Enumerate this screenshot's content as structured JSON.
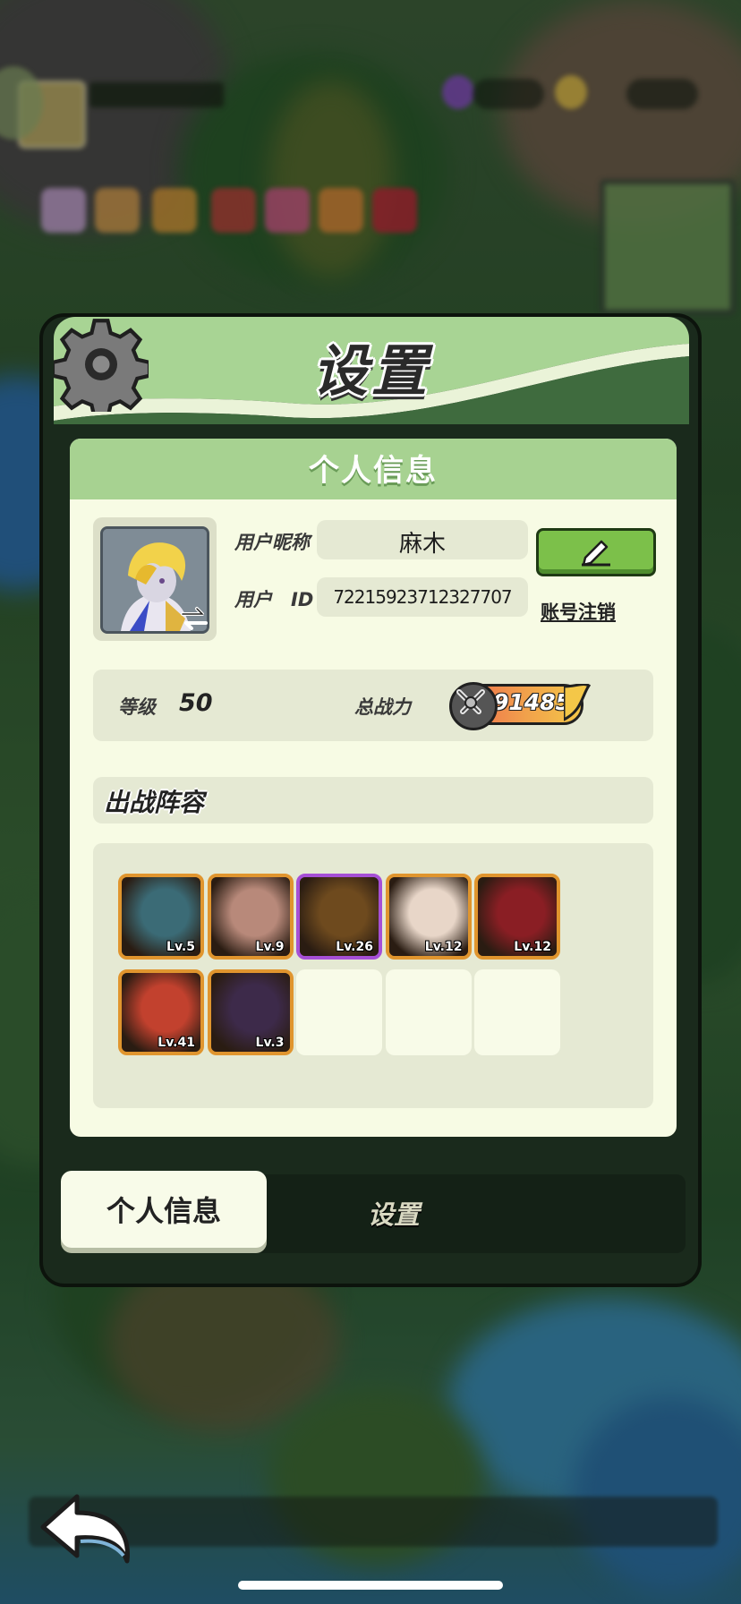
{
  "dialog": {
    "title": "设置"
  },
  "personal_info": {
    "header": "个人信息",
    "nickname_label": "用户昵称",
    "nickname": "麻木",
    "id_label": "用户　ID",
    "user_id": "72215923712327707",
    "delete_account": "账号注销",
    "level_label": "等级",
    "level": "50",
    "power_label": "总战力",
    "power": "91485"
  },
  "lineup": {
    "title": "出战阵容",
    "heroes": [
      {
        "level": "Lv.5",
        "rarity": "rare",
        "color": "#3b6b76"
      },
      {
        "level": "Lv.9",
        "rarity": "rare",
        "color": "#b8897a"
      },
      {
        "level": "Lv.26",
        "rarity": "epic",
        "color": "#6e4a1e"
      },
      {
        "level": "Lv.12",
        "rarity": "rare",
        "color": "#e8d6c8"
      },
      {
        "level": "Lv.12",
        "rarity": "rare",
        "color": "#8a1e24"
      },
      {
        "level": "Lv.41",
        "rarity": "rare",
        "color": "#c2412e"
      },
      {
        "level": "Lv.3",
        "rarity": "rare",
        "color": "#3d2a4a"
      },
      {
        "level": "",
        "rarity": "empty"
      },
      {
        "level": "",
        "rarity": "empty"
      },
      {
        "level": "",
        "rarity": "empty"
      }
    ]
  },
  "tabs": [
    {
      "label": "个人信息",
      "active": true
    },
    {
      "label": "设置",
      "active": false
    }
  ],
  "icons": {
    "gear": "gear-icon",
    "edit": "pen-icon",
    "swap": "swap-avatar-icon",
    "power": "crossed-swords-icon",
    "back": "back-arrow-icon"
  },
  "colors": {
    "panel_bg": "#f7fbe4",
    "panel_header": "#a7d291",
    "edit_button": "#7cc04a",
    "rare_border": "#e0952e",
    "epic_border": "#a64fd6"
  }
}
